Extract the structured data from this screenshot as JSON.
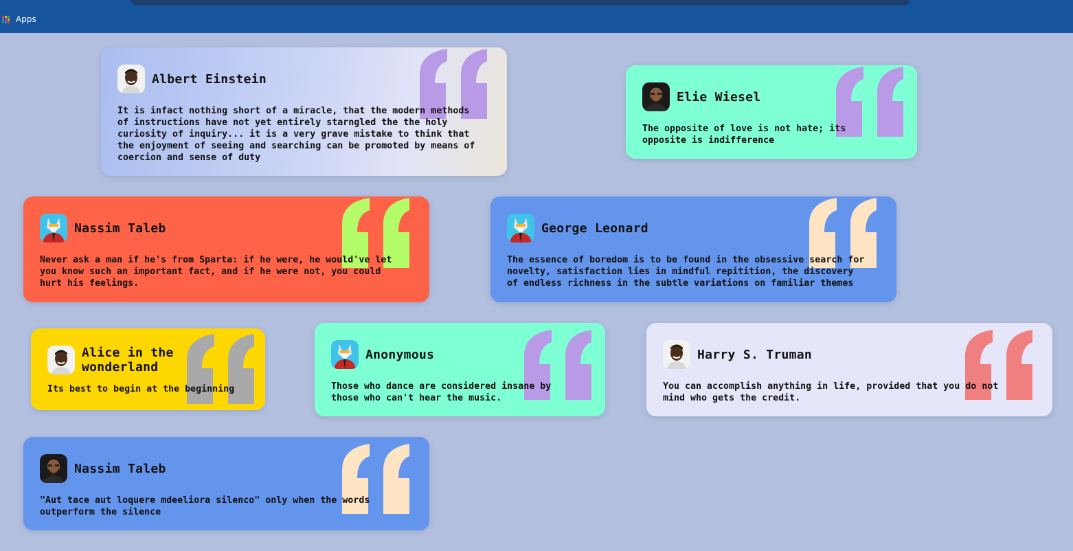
{
  "browser": {
    "apps_label": "Apps"
  },
  "cards": [
    {
      "name": "Albert Einstein",
      "quote": "It is infact nothing short of a miracle, that the modern methods\nof instructions have not yet entirely starngled the the holy\ncuriosity of inquiry... it is a very grave mistake to think that\nthe enjoyment of seeing and searching can be promoted by means of\ncoercion and sense of duty",
      "avatar": "man-avatar",
      "background": "gradient-periwinkle",
      "quote_color": "#b99ae6"
    },
    {
      "name": "Elie Wiesel",
      "quote": "The opposite of love is not hate; its\nopposite is indifference",
      "avatar": "bearded-man-avatar",
      "background": "#7fffd4",
      "quote_color": "#b99ae6"
    },
    {
      "name": "Nassim Taleb",
      "quote": "Never ask a man if he's from Sparta: if he were, he would've let\nyou know such an important fact, and if he were not, you could\nhurt his feelings.",
      "avatar": "wolf-avatar",
      "background": "#ff6347",
      "quote_color": "#b5fc6a"
    },
    {
      "name": "George Leonard",
      "quote": "The essence of boredom is to be found in the obsessive search for\nnovelty, satisfaction lies in mindful repitition, the discovery\nof endless richness in the subtle variations on familiar themes",
      "avatar": "wolf-avatar",
      "background": "#6495ed",
      "quote_color": "#ffe4c4"
    },
    {
      "name": "Alice in the wonderland",
      "quote": "Its best to begin at the beginning",
      "avatar": "man-avatar",
      "background": "#ffd700",
      "quote_color": "#a9a9a9"
    },
    {
      "name": "Anonymous",
      "quote": "Those who dance are considered insane by\nthose who can't hear the music.",
      "avatar": "wolf-avatar",
      "background": "#7fffd4",
      "quote_color": "#b99ae6"
    },
    {
      "name": "Harry S. Truman",
      "quote": "You can accomplish anything in life, provided that you do not\nmind who gets the credit.",
      "avatar": "man-avatar",
      "background": "#e6e6fa",
      "quote_color": "#f08080"
    },
    {
      "name": "Nassim Taleb",
      "quote": "\"Aut tace aut loquere mdeeliora silenco\" only when the words\noutperform the silence",
      "avatar": "bearded-man-avatar",
      "background": "#6495ed",
      "quote_color": "#ffe4c4"
    }
  ]
}
